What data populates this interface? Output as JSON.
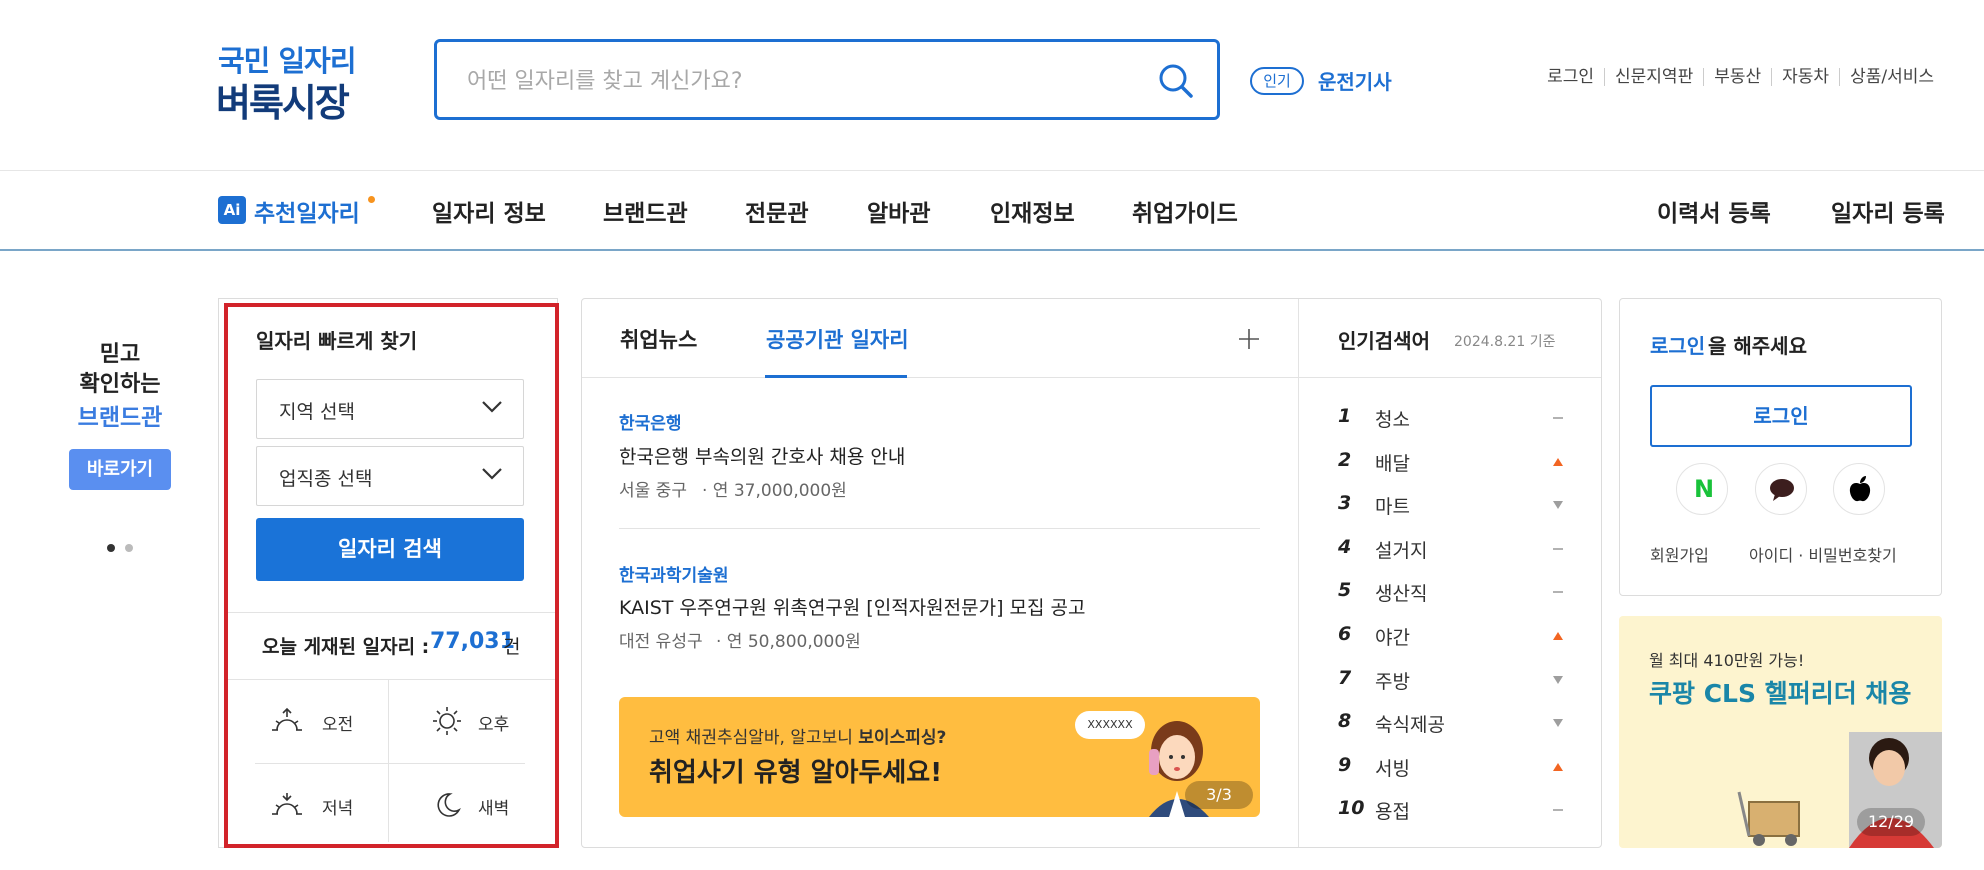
{
  "logo": {
    "line1": "국민 일자리",
    "line2": "벼룩시장"
  },
  "search": {
    "placeholder": "어떤 일자리를 찾고 계신가요?"
  },
  "popular_tag": {
    "badge": "인기",
    "keyword": "운전기사"
  },
  "util_links": [
    "로그인",
    "신문지역판",
    "부동산",
    "자동차",
    "상품/서비스"
  ],
  "nav": {
    "ai_badge": "Ai",
    "recommended": "추천일자리",
    "items": [
      "일자리 정보",
      "브랜드관",
      "전문관",
      "알바관",
      "인재정보",
      "취업가이드"
    ],
    "right": [
      "이력서 등록",
      "일자리 등록"
    ]
  },
  "brand_promo": {
    "line1": "믿고",
    "line2": "확인하는",
    "line3": "브랜드관",
    "button": "바로가기"
  },
  "quick": {
    "title": "일자리 빠르게 찾기",
    "region": "지역 선택",
    "job_type": "업직종 선택",
    "search_button": "일자리 검색",
    "today_label": "오늘 게재된 일자리 :",
    "today_count": "77,031",
    "today_unit": "건",
    "times": [
      "오전",
      "오후",
      "저녁",
      "새벽"
    ]
  },
  "news": {
    "tabs": [
      "취업뉴스",
      "공공기관 일자리"
    ],
    "active_tab": "공공기관 일자리",
    "items": [
      {
        "org": "한국은행",
        "title": "한국은행 부속의원 간호사 채용 안내",
        "location": "서울 중구",
        "salary": "· 연 37,000,000원"
      },
      {
        "org": "한국과학기술원",
        "title": "KAIST 우주연구원 위촉연구원 [인적자원전문가] 모집 공고",
        "location": "대전 유성구",
        "salary": "· 연 50,800,000원"
      }
    ],
    "banner": {
      "line1_prefix": "고액 채권추심알바, 알고보니 ",
      "line1_em": "보이스피싱?",
      "line2": "취업사기 유형 알아두세요!",
      "bubble": "XXXXXX",
      "counter": "3/3"
    }
  },
  "popular": {
    "title": "인기검색어",
    "date": "2024.8.21 기준",
    "items": [
      {
        "rank": "1",
        "word": "청소",
        "trend": "same"
      },
      {
        "rank": "2",
        "word": "배달",
        "trend": "up"
      },
      {
        "rank": "3",
        "word": "마트",
        "trend": "down"
      },
      {
        "rank": "4",
        "word": "설거지",
        "trend": "same"
      },
      {
        "rank": "5",
        "word": "생산직",
        "trend": "same"
      },
      {
        "rank": "6",
        "word": "야간",
        "trend": "up"
      },
      {
        "rank": "7",
        "word": "주방",
        "trend": "down"
      },
      {
        "rank": "8",
        "word": "숙식제공",
        "trend": "down"
      },
      {
        "rank": "9",
        "word": "서빙",
        "trend": "up"
      },
      {
        "rank": "10",
        "word": "용접",
        "trend": "same"
      }
    ]
  },
  "login": {
    "prompt_em": "로그인",
    "prompt_rest": "을 해주세요",
    "button": "로그인",
    "sns": [
      "N",
      "",
      ""
    ],
    "signup": "회원가입",
    "find": "아이디 · 비밀번호찾기"
  },
  "ad": {
    "line1": "월 최대 410만원 가능!",
    "line2": "쿠팡 CLS 헬퍼리더 채용",
    "counter": "12/29"
  },
  "colors": {
    "brand_blue": "#1d6fd2",
    "highlight_red": "#d2232a",
    "up": "#f26522",
    "down": "#9e9e9e",
    "banner": "#ffbd40"
  }
}
